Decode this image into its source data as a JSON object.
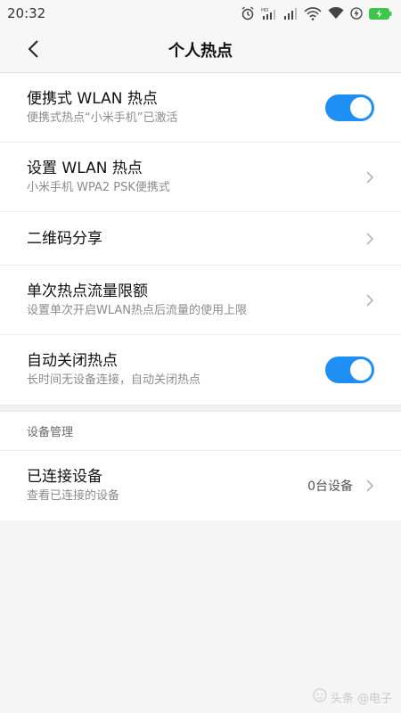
{
  "status_bar": {
    "time": "20:32",
    "battery_color": "#3ec64a"
  },
  "header": {
    "title": "个人热点"
  },
  "settings": [
    {
      "title": "便携式 WLAN 热点",
      "subtitle": "便携式热点“小米手机”已激活",
      "control": "toggle",
      "on": true
    },
    {
      "title": "设置 WLAN 热点",
      "subtitle": "小米手机 WPA2 PSK便携式",
      "control": "chevron"
    },
    {
      "title": "二维码分享",
      "control": "chevron"
    },
    {
      "title": "单次热点流量限额",
      "subtitle": "设置单次开启WLAN热点后流量的使用上限",
      "control": "chevron"
    },
    {
      "title": "自动关闭热点",
      "subtitle": "长时间无设备连接，自动关闭热点",
      "control": "toggle",
      "on": true
    }
  ],
  "device_section": {
    "header": "设备管理",
    "connected": {
      "title": "已连接设备",
      "subtitle": "查看已连接的设备",
      "value": "0台设备"
    }
  },
  "watermark": {
    "text": "头条 @电子"
  },
  "colors": {
    "toggle_on": "#1e90f5",
    "page_background": "#f5f5f5"
  }
}
